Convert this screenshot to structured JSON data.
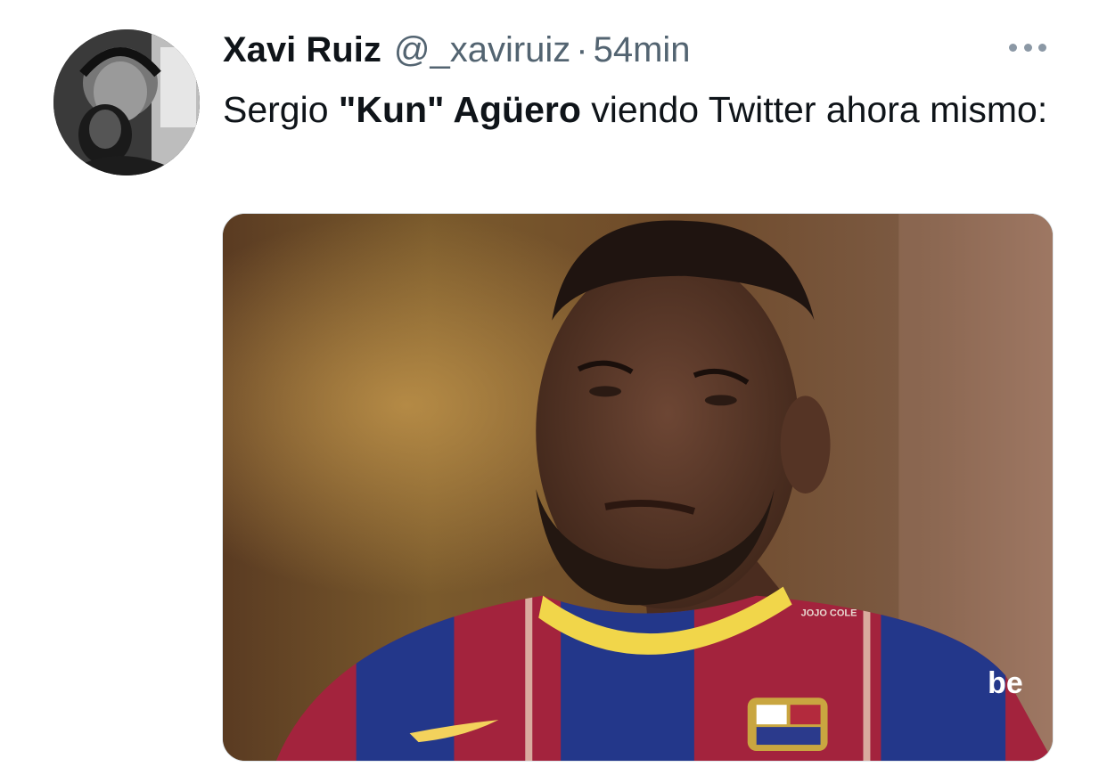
{
  "tweet": {
    "author_name": "Xavi Ruiz",
    "handle": "@_xaviruiz",
    "separator": "·",
    "time": "54min",
    "text_parts": [
      "Sergio ",
      "\"Kun\" Agüero",
      " viendo Twitter ahora mismo:"
    ],
    "media_jersey_text": "JOJO COLE",
    "media_sponsor_text": "be"
  },
  "icons": {
    "avatar": "user-avatar-photo",
    "more": "more-horizontal-icon"
  },
  "colors": {
    "text_primary": "#0f1419",
    "text_secondary": "#536471",
    "more_dots": "#8b98a5"
  }
}
